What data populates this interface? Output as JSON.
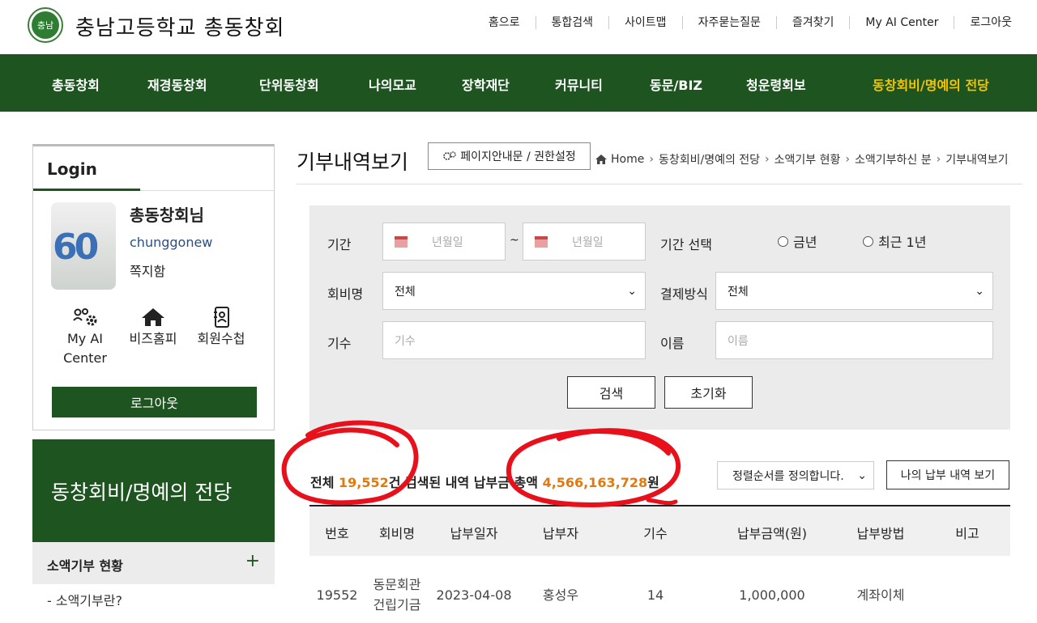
{
  "header": {
    "logo_text": "충남",
    "site_title": "충남고등학교 총동창회",
    "util_links": [
      "홈으로",
      "통합검색",
      "사이트맵",
      "자주묻는질문",
      "즐겨찾기",
      "My AI Center",
      "로그아웃"
    ]
  },
  "gnb": {
    "items": [
      "총동창회",
      "재경동창회",
      "단위동창회",
      "나의모교",
      "장학재단",
      "커뮤니티",
      "동문/BIZ",
      "청운령회보",
      "동창회비/명예의 전당"
    ],
    "active_index": 8
  },
  "login": {
    "title": "Login",
    "user_name": "총동창회님",
    "user_id": "chunggonew",
    "message_label": "쪽지함",
    "quick_links": [
      "My AI Center",
      "비즈홈피",
      "회원수첩"
    ],
    "logout_label": "로그아웃"
  },
  "sidebar": {
    "section_title": "동창회비/명예의 전당",
    "menu_label": "소액기부 현황",
    "menu_toggle": "+",
    "sub_item": "-  소액기부란?"
  },
  "main": {
    "page_title": "기부내역보기",
    "guide_button": "페이지안내문 / 권한설정",
    "breadcrumb": [
      "Home",
      "동창회비/명예의 전당",
      "소액기부 현황",
      "소액기부하신 분",
      "기부내역보기"
    ]
  },
  "search": {
    "period_label": "기간",
    "date_placeholder_from": "년월일",
    "date_placeholder_to": "년월일",
    "period_select_label": "기간 선택",
    "radio_this_year": "금년",
    "radio_last_year": "최근 1년",
    "fee_label": "회비명",
    "fee_value": "전체",
    "payment_label": "결제방식",
    "payment_value": "전체",
    "class_label": "기수",
    "class_placeholder": "기수",
    "name_label": "이름",
    "name_placeholder": "이름",
    "search_button": "검색",
    "reset_button": "초기화"
  },
  "summary": {
    "prefix": "전체 ",
    "total_count": "19,552",
    "count_suffix": "건",
    "middle": "  검색된 내역 납부금 총액 ",
    "total_amount": "4,566,163,728",
    "amount_suffix": "원",
    "sort_placeholder": "정렬순서를 정의합니다.",
    "my_button": "나의 납부 내역 보기"
  },
  "table": {
    "headers": [
      "번호",
      "회비명",
      "납부일자",
      "납부자",
      "기수",
      "납부금액(원)",
      "납부방법",
      "비고"
    ],
    "rows": [
      {
        "no": "19552",
        "fee_line1": "동문회관",
        "fee_line2": "건립기금",
        "date": "2023-04-08",
        "payer": "홍성우",
        "class": "14",
        "amount": "1,000,000",
        "method": "계좌이체",
        "note": ""
      }
    ]
  },
  "colors": {
    "brand_green": "#1d5420",
    "active_nav": "#f5c400",
    "highlight_number": "#e07a10",
    "annotation_red": "#e8101a"
  }
}
